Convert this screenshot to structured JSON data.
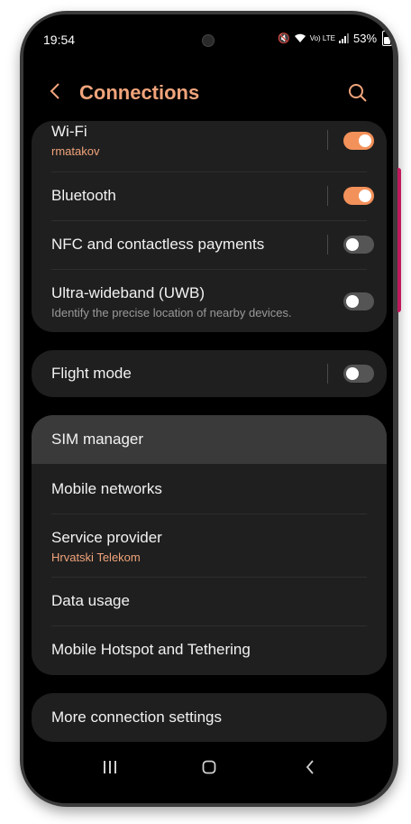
{
  "status": {
    "time": "19:54",
    "lte_label": "Vo) LTE",
    "battery": "53%"
  },
  "header": {
    "title": "Connections"
  },
  "connections": [
    {
      "label": "Wi-Fi",
      "sub": "rmatakov",
      "toggle": true
    },
    {
      "label": "Bluetooth",
      "toggle": true
    },
    {
      "label": "NFC and contactless payments",
      "toggle": false
    },
    {
      "label": "Ultra-wideband (UWB)",
      "sub": "Identify the precise location of nearby devices.",
      "toggle": false
    }
  ],
  "flight": {
    "label": "Flight mode",
    "toggle": false
  },
  "sim_group": [
    {
      "label": "SIM manager"
    },
    {
      "label": "Mobile networks"
    },
    {
      "label": "Service provider",
      "sub": "Hrvatski Telekom"
    },
    {
      "label": "Data usage"
    },
    {
      "label": "Mobile Hotspot and Tethering"
    }
  ],
  "more": {
    "label": "More connection settings"
  },
  "nav_icons": [
    "recent-apps-icon",
    "home-icon",
    "back-icon"
  ],
  "colors": {
    "accent": "#f1a47b",
    "toggle_on": "#f3915a",
    "card": "#1f1f1f",
    "background": "#000000"
  }
}
